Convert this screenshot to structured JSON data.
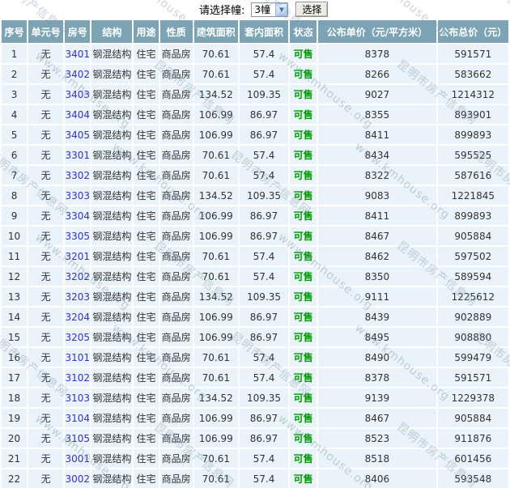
{
  "controls": {
    "label": "请选择幢:",
    "building_select_value": "3幢",
    "dropdown_arrow_icon": "▼",
    "select_button_label": "选择"
  },
  "table": {
    "columns": [
      "序号",
      "单元号",
      "房号",
      "结构",
      "用途",
      "性质",
      "建筑面积",
      "套内面积",
      "状态",
      "公布单价（元/平方米）",
      "公布总价（元）"
    ],
    "rows": [
      {
        "seq": "1",
        "unit": "无",
        "room": "3401",
        "structure": "钢混结构",
        "use": "住宅",
        "nature": "商品房",
        "area": "70.61",
        "inner_area": "57.4",
        "status": "可售",
        "unit_price": "8378",
        "total_price": "591571"
      },
      {
        "seq": "2",
        "unit": "无",
        "room": "3402",
        "structure": "钢混结构",
        "use": "住宅",
        "nature": "商品房",
        "area": "70.61",
        "inner_area": "57.4",
        "status": "可售",
        "unit_price": "8266",
        "total_price": "583662"
      },
      {
        "seq": "3",
        "unit": "无",
        "room": "3403",
        "structure": "钢混结构",
        "use": "住宅",
        "nature": "商品房",
        "area": "134.52",
        "inner_area": "109.35",
        "status": "可售",
        "unit_price": "9027",
        "total_price": "1214312"
      },
      {
        "seq": "4",
        "unit": "无",
        "room": "3404",
        "structure": "钢混结构",
        "use": "住宅",
        "nature": "商品房",
        "area": "106.99",
        "inner_area": "86.97",
        "status": "可售",
        "unit_price": "8355",
        "total_price": "893901"
      },
      {
        "seq": "5",
        "unit": "无",
        "room": "3405",
        "structure": "钢混结构",
        "use": "住宅",
        "nature": "商品房",
        "area": "106.99",
        "inner_area": "86.97",
        "status": "可售",
        "unit_price": "8411",
        "total_price": "899893"
      },
      {
        "seq": "6",
        "unit": "无",
        "room": "3301",
        "structure": "钢混结构",
        "use": "住宅",
        "nature": "商品房",
        "area": "70.61",
        "inner_area": "57.4",
        "status": "可售",
        "unit_price": "8434",
        "total_price": "595525"
      },
      {
        "seq": "7",
        "unit": "无",
        "room": "3302",
        "structure": "钢混结构",
        "use": "住宅",
        "nature": "商品房",
        "area": "70.61",
        "inner_area": "57.4",
        "status": "可售",
        "unit_price": "8322",
        "total_price": "587616"
      },
      {
        "seq": "8",
        "unit": "无",
        "room": "3303",
        "structure": "钢混结构",
        "use": "住宅",
        "nature": "商品房",
        "area": "134.52",
        "inner_area": "109.35",
        "status": "可售",
        "unit_price": "9083",
        "total_price": "1221845"
      },
      {
        "seq": "9",
        "unit": "无",
        "room": "3304",
        "structure": "钢混结构",
        "use": "住宅",
        "nature": "商品房",
        "area": "106.99",
        "inner_area": "86.97",
        "status": "可售",
        "unit_price": "8411",
        "total_price": "899893"
      },
      {
        "seq": "10",
        "unit": "无",
        "room": "3305",
        "structure": "钢混结构",
        "use": "住宅",
        "nature": "商品房",
        "area": "106.99",
        "inner_area": "86.97",
        "status": "可售",
        "unit_price": "8467",
        "total_price": "905884"
      },
      {
        "seq": "11",
        "unit": "无",
        "room": "3201",
        "structure": "钢混结构",
        "use": "住宅",
        "nature": "商品房",
        "area": "70.61",
        "inner_area": "57.4",
        "status": "可售",
        "unit_price": "8462",
        "total_price": "597502"
      },
      {
        "seq": "12",
        "unit": "无",
        "room": "3202",
        "structure": "钢混结构",
        "use": "住宅",
        "nature": "商品房",
        "area": "70.61",
        "inner_area": "57.4",
        "status": "可售",
        "unit_price": "8350",
        "total_price": "589594"
      },
      {
        "seq": "13",
        "unit": "无",
        "room": "3203",
        "structure": "钢混结构",
        "use": "住宅",
        "nature": "商品房",
        "area": "134.52",
        "inner_area": "109.35",
        "status": "可售",
        "unit_price": "9111",
        "total_price": "1225612"
      },
      {
        "seq": "14",
        "unit": "无",
        "room": "3204",
        "structure": "钢混结构",
        "use": "住宅",
        "nature": "商品房",
        "area": "106.99",
        "inner_area": "86.97",
        "status": "可售",
        "unit_price": "8439",
        "total_price": "902889"
      },
      {
        "seq": "15",
        "unit": "无",
        "room": "3205",
        "structure": "钢混结构",
        "use": "住宅",
        "nature": "商品房",
        "area": "106.99",
        "inner_area": "86.97",
        "status": "可售",
        "unit_price": "8495",
        "total_price": "908880"
      },
      {
        "seq": "16",
        "unit": "无",
        "room": "3101",
        "structure": "钢混结构",
        "use": "住宅",
        "nature": "商品房",
        "area": "70.61",
        "inner_area": "57.4",
        "status": "可售",
        "unit_price": "8490",
        "total_price": "599479"
      },
      {
        "seq": "17",
        "unit": "无",
        "room": "3102",
        "structure": "钢混结构",
        "use": "住宅",
        "nature": "商品房",
        "area": "70.61",
        "inner_area": "57.4",
        "status": "可售",
        "unit_price": "8378",
        "total_price": "591571"
      },
      {
        "seq": "18",
        "unit": "无",
        "room": "3103",
        "structure": "钢混结构",
        "use": "住宅",
        "nature": "商品房",
        "area": "134.52",
        "inner_area": "109.35",
        "status": "可售",
        "unit_price": "9139",
        "total_price": "1229378"
      },
      {
        "seq": "19",
        "unit": "无",
        "room": "3104",
        "structure": "钢混结构",
        "use": "住宅",
        "nature": "商品房",
        "area": "106.99",
        "inner_area": "86.97",
        "status": "可售",
        "unit_price": "8467",
        "total_price": "905884"
      },
      {
        "seq": "20",
        "unit": "无",
        "room": "3105",
        "structure": "钢混结构",
        "use": "住宅",
        "nature": "商品房",
        "area": "106.99",
        "inner_area": "86.97",
        "status": "可售",
        "unit_price": "8523",
        "total_price": "911876"
      },
      {
        "seq": "21",
        "unit": "无",
        "room": "3001",
        "structure": "钢混结构",
        "use": "住宅",
        "nature": "商品房",
        "area": "70.61",
        "inner_area": "57.4",
        "status": "可售",
        "unit_price": "8518",
        "total_price": "601456"
      },
      {
        "seq": "22",
        "unit": "无",
        "room": "3002",
        "structure": "钢混结构",
        "use": "住宅",
        "nature": "商品房",
        "area": "70.61",
        "inner_area": "57.4",
        "status": "可售",
        "unit_price": "8406",
        "total_price": "593548"
      }
    ]
  },
  "watermark": {
    "texts": [
      "昆明市房产信息网",
      "www.kmhouse.org"
    ]
  },
  "colors": {
    "header_bg": "#7CA4B4",
    "row_bg": "#E9F3F9",
    "status_green": "#009900",
    "room_link_blue": "#3333CC",
    "watermark": "rgba(125,150,168,0.42)"
  }
}
